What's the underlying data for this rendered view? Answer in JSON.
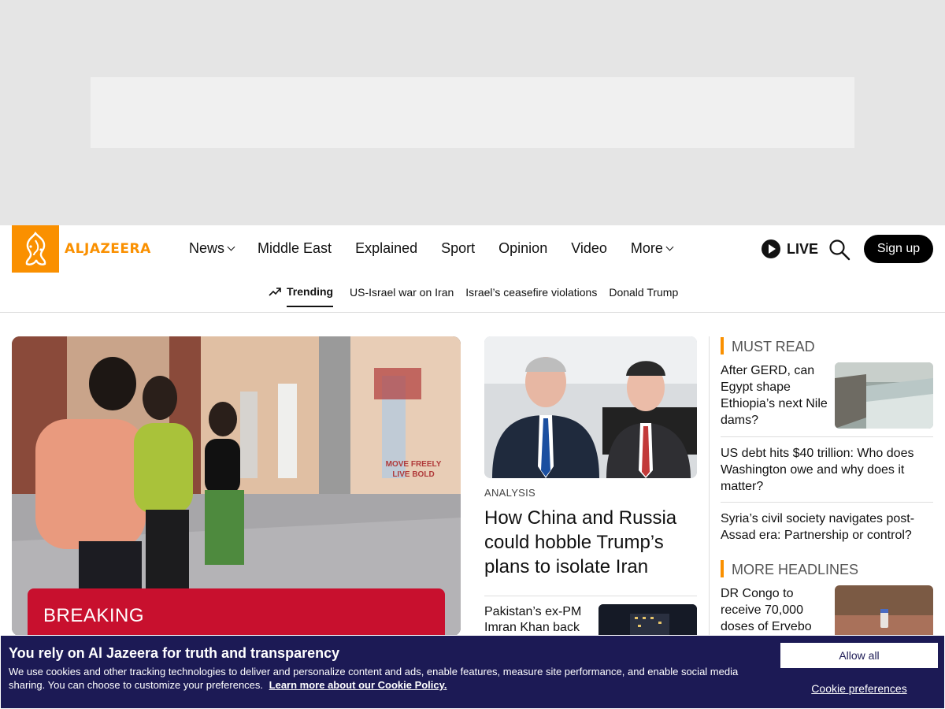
{
  "brand": {
    "name": "ALJAZEERA",
    "accent": "#fa9000"
  },
  "nav": {
    "items": [
      {
        "label": "News",
        "dropdown": true
      },
      {
        "label": "Middle East",
        "dropdown": false
      },
      {
        "label": "Explained",
        "dropdown": false
      },
      {
        "label": "Sport",
        "dropdown": false
      },
      {
        "label": "Opinion",
        "dropdown": false
      },
      {
        "label": "Video",
        "dropdown": false
      },
      {
        "label": "More",
        "dropdown": true
      }
    ],
    "live_label": "LIVE",
    "signup_label": "Sign up"
  },
  "trending": {
    "label": "Trending",
    "links": [
      "US-Israel war on Iran",
      "Israel’s ceasefire violations",
      "Donald Trump"
    ]
  },
  "hero": {
    "badge": "BREAKING",
    "badge_color": "#c8102e",
    "image": {
      "sign_text_1": "MOVE FREELY",
      "sign_text_2": "LIVE BOLD"
    }
  },
  "middle": {
    "tag": "ANALYSIS",
    "title": "How China and Russia could hobble Trump’s plans to isolate Iran",
    "small_story": "Pakistan’s ex-PM Imran Khan back"
  },
  "must_read": {
    "heading": "MUST READ",
    "items": [
      "After GERD, can Egypt shape Ethiopia’s next Nile dams?",
      "US debt hits $40 trillion: Who does Washington owe and why does it matter?",
      "Syria’s civil society navigates post-Assad era: Partnership or control?"
    ]
  },
  "more_headlines": {
    "heading": "MORE HEADLINES",
    "items": [
      "DR Congo to receive 70,000 doses of Ervebo"
    ]
  },
  "cookie": {
    "title": "You rely on Al Jazeera for truth and transparency",
    "text": "We use cookies and other tracking technologies to deliver and personalize content and ads, enable features, measure site performance, and enable social media sharing. You can choose to customize your preferences.",
    "link": "Learn more about our Cookie Policy.",
    "allow_label": "Allow all",
    "prefs_label": "Cookie preferences",
    "bg_color": "#1c1a55"
  }
}
